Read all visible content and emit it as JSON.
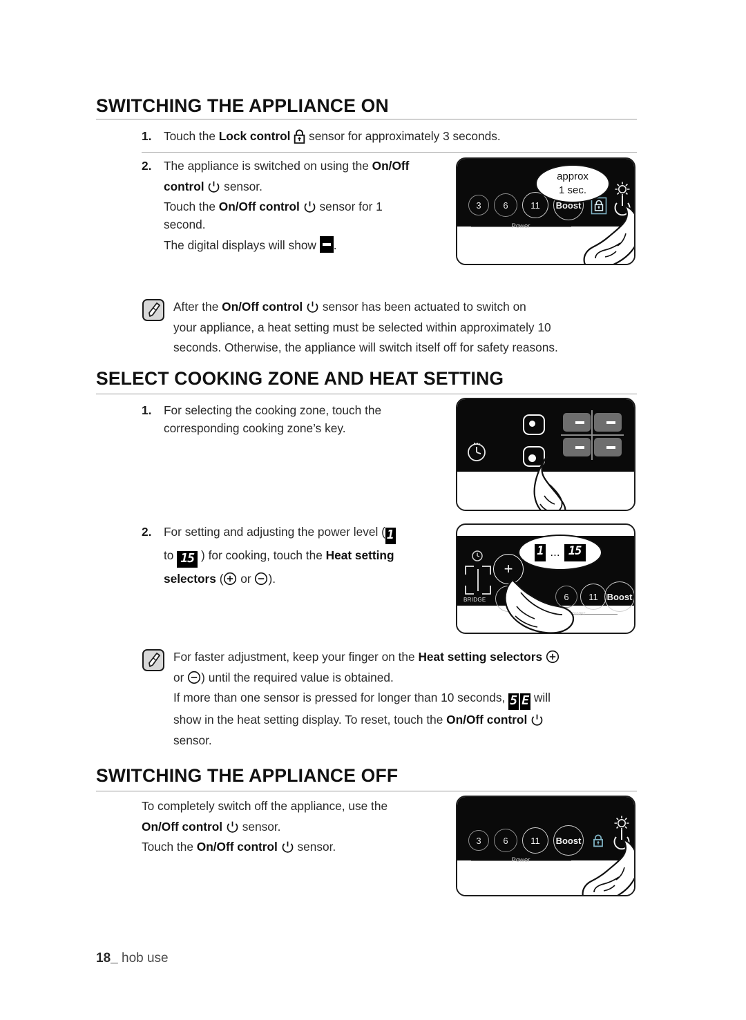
{
  "document": {
    "footer_page": "18",
    "footer_sep": "_",
    "footer_label": "hob use"
  },
  "sections": [
    {
      "id": "switching-on",
      "heading": "SWITCHING THE APPLIANCE ON",
      "steps": [
        {
          "number": "1.",
          "text_a": "Touch the ",
          "bold_a": "Lock control",
          "icon": "lock-icon",
          "text_b": " sensor for approximately 3 seconds."
        },
        {
          "number": "2.",
          "line1_a": "The appliance is switched on using the ",
          "line1_b": "On/Off",
          "line2_b": "control",
          "line2_icon": "power-icon",
          "line2_c": " sensor.",
          "line3_a": "Touch the ",
          "line3_b": "On/Off control",
          "line3_icon": "power-icon",
          "line3_c": " sensor for 1",
          "line4": "second.",
          "line5_a": "The digital displays will show ",
          "line5_display": "-",
          "line5_b": "."
        }
      ]
    },
    {
      "id": "select-zone",
      "heading": "SELECT COOKING ZONE AND HEAT SETTING",
      "steps": [
        {
          "number": "1.",
          "line1": "For selecting the cooking zone, touch the",
          "line2": "corresponding cooking zone’s key."
        },
        {
          "number": "2.",
          "line1_a": "For setting and adjusting the power level (",
          "level_min": "1",
          "line2_a": "to ",
          "level_max": "15",
          "line2_b": " ) for cooking, touch the ",
          "line2_bold": "Heat setting",
          "line3_bold": "selectors",
          "line3_a": " (",
          "plus_icon": "circle-plus-icon",
          "line3_or": " or ",
          "minus_icon": "circle-minus-icon",
          "line3_b": ")."
        }
      ]
    },
    {
      "id": "switching-off",
      "heading": "SWITCHING THE APPLIANCE OFF",
      "body": {
        "line1": "To completely switch off the appliance, use the",
        "line2_bold": "On/Off control",
        "line2_icon": "power-icon",
        "line2_a": " sensor.",
        "line3_a": "Touch the ",
        "line3_bold": "On/Off control",
        "line3_icon": "power-icon",
        "line3_b": " sensor."
      }
    }
  ],
  "notes": [
    {
      "id": "note-heat-setting-timeout",
      "icon": "note-pencil-icon",
      "line1_a": "After the ",
      "line1_bold": "On/Off control",
      "line1_icon": "power-icon",
      "line1_b": " sensor has been actuated to switch on",
      "line2": "your appliance, a heat setting must be selected within approximately 10",
      "line3": "seconds. Otherwise, the appliance will switch itself off for safety reasons."
    },
    {
      "id": "note-faster-adjustment",
      "icon": "note-pencil-icon",
      "line1_a": "For faster adjustment, keep your finger on the ",
      "line1_bold": "Heat setting selectors",
      "line1_icon": "circle-plus-icon",
      "line2_a": "or ",
      "line2_icon": "circle-minus-icon",
      "line2_b": ") until the required value is obtained.",
      "line3_a": "If more than one sensor is pressed for longer than 10 seconds, ",
      "error_digit_1": "5",
      "error_digit_2": "E",
      "line3_b": " will",
      "line4_a": "show in the heat setting display. To reset, touch the ",
      "line4_bold": "On/Off control",
      "line4_icon": "power-icon",
      "line5": "sensor."
    }
  ],
  "illustrations": [
    {
      "id": "hob-switch-on",
      "keys": [
        "3",
        "6",
        "11",
        "Boost"
      ],
      "power_label": "Power",
      "lock_icon": "lock-icon",
      "power_icon": "power-icon",
      "bubble_line1": "approx",
      "bubble_line2": "1 sec.",
      "hand": "pointing-finger"
    },
    {
      "id": "hob-select-zone",
      "timer_icon": "timer-clock-icon",
      "zone_keys": [
        "zone-key-rear",
        "zone-key-front"
      ],
      "display_tiles": [
        "-",
        "-",
        "-",
        "-"
      ],
      "hand": "pointing-finger"
    },
    {
      "id": "hob-heat-setting",
      "timer_icon": "timer-clock-icon",
      "bridge_label": "BRIDGE",
      "plus_key": "+",
      "minus_key": "−",
      "keys": [
        "6",
        "11",
        "Boost"
      ],
      "power_label": "Power",
      "bubble_min": "1",
      "bubble_dots": "...",
      "bubble_max": "15",
      "hand": "pointing-finger"
    },
    {
      "id": "hob-switch-off",
      "keys": [
        "3",
        "6",
        "11",
        "Boost"
      ],
      "power_label": "Power",
      "lock_icon": "lock-icon",
      "power_icon": "power-icon",
      "hand": "pointing-finger"
    }
  ],
  "colors": {
    "panel_black": "#0a0a0a",
    "lock_teal": "#7fb3c4",
    "display_grey": "#6e6e6e",
    "rule_grey": "#9a9a9a"
  }
}
